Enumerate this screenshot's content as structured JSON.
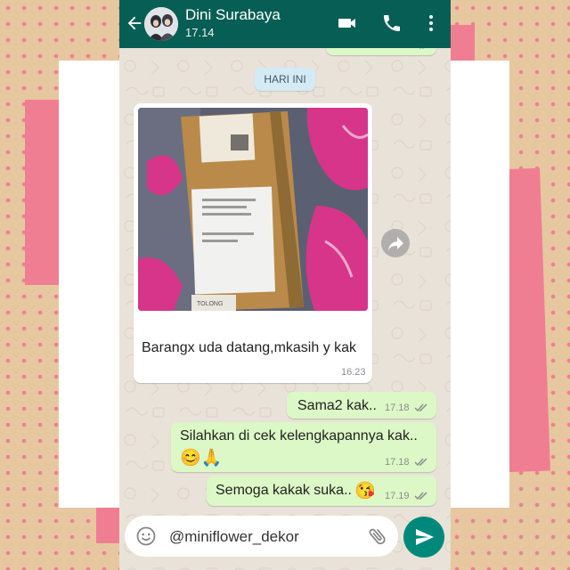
{
  "header": {
    "contact_name": "Dini Surabaya",
    "last_seen": "17.14"
  },
  "previous_message": {
    "time": "17.18"
  },
  "date_divider": "HARI INI",
  "messages": [
    {
      "direction": "incoming",
      "type": "image",
      "caption": "Barangx uda datang,mkasih y kak",
      "time": "16.23",
      "image_label": "TOLONG"
    },
    {
      "direction": "outgoing",
      "text": "Sama2 kak..",
      "time": "17.18",
      "status": "read"
    },
    {
      "direction": "outgoing",
      "text": "Silahkan di cek kelengkapannya kak..",
      "emoji": "😊🙏",
      "time": "17.18",
      "status": "read"
    },
    {
      "direction": "outgoing",
      "text": "Semoga kakak suka..",
      "emoji": "😘",
      "time": "17.19",
      "status": "read"
    }
  ],
  "composer": {
    "value": "@miniflower_dekor"
  },
  "colors": {
    "header": "#075e54",
    "outgoing_bubble": "#dcf8c6",
    "incoming_bubble": "#ffffff",
    "send_button": "#00897b",
    "frame_pink": "#f07e93",
    "frame_tan": "#e6c7a0"
  },
  "icons": [
    "back-arrow-icon",
    "video-call-icon",
    "phone-call-icon",
    "more-vert-icon",
    "forward-icon",
    "emoji-icon",
    "attach-icon",
    "send-icon",
    "read-ticks-icon"
  ]
}
